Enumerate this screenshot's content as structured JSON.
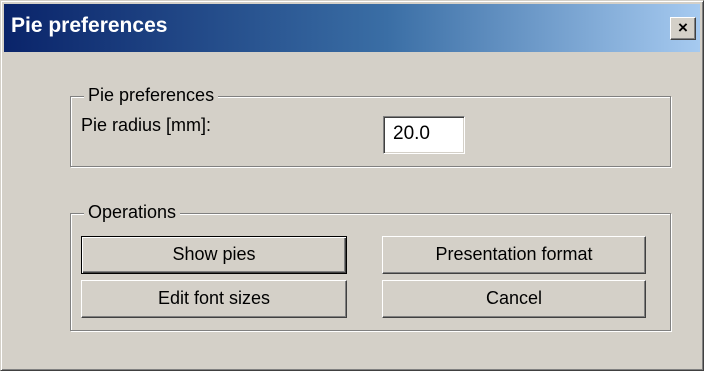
{
  "window": {
    "title": "Pie preferences",
    "close_glyph": "×"
  },
  "preferences_group": {
    "legend": "Pie preferences",
    "radius_label": "Pie radius [mm]:",
    "radius_value": "20.0"
  },
  "operations_group": {
    "legend": "Operations",
    "show_pies": "Show pies",
    "presentation_format": "Presentation format",
    "edit_font_sizes": "Edit font sizes",
    "cancel": "Cancel"
  },
  "colors": {
    "dialog_face": "#d4d0c8",
    "title_gradient_start": "#0a246a",
    "title_gradient_end": "#a6caf0"
  }
}
